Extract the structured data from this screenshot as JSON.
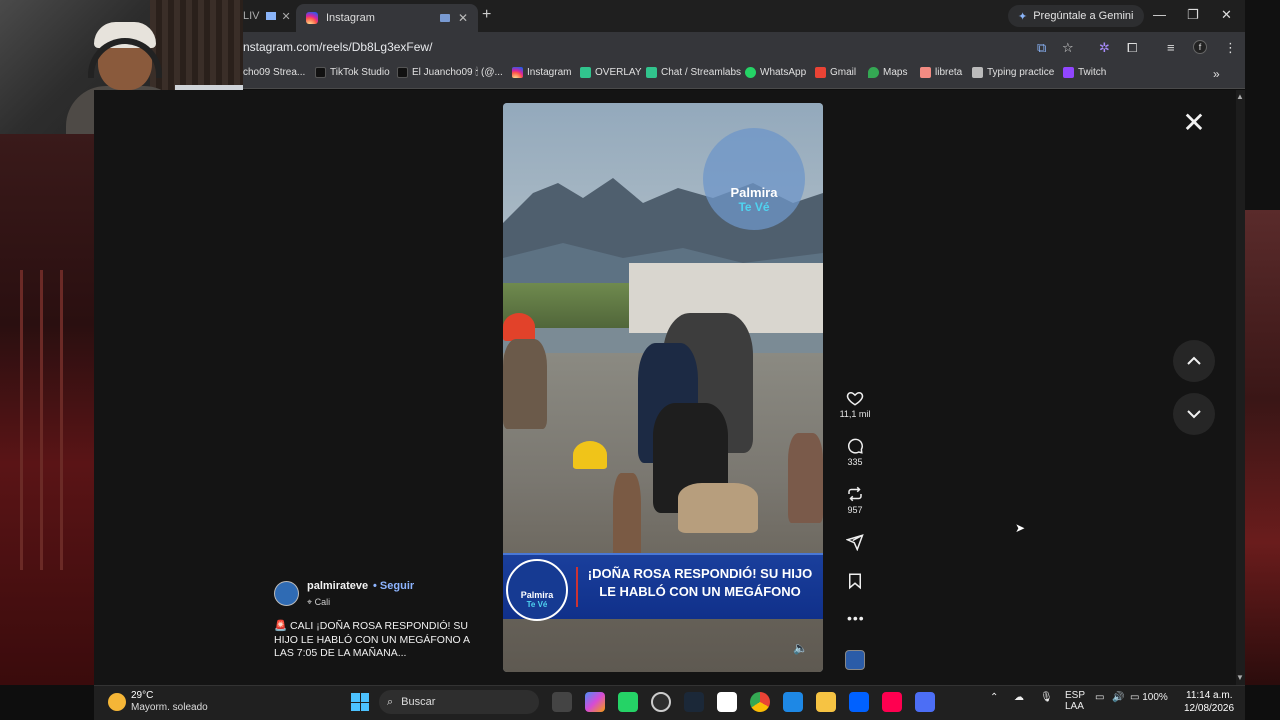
{
  "browser": {
    "partial_tab_label": "LIV",
    "active_tab_title": "Instagram",
    "new_tab_symbol": "+",
    "gemini_label": "Pregúntale a Gemini",
    "url": "nstagram.com/reels/Db8Lg3exFew/"
  },
  "bookmarks": [
    {
      "label": "cho09 Strea...",
      "icon": "streamlabs-icon",
      "color": "#80f5d2"
    },
    {
      "label": "TikTok Studio",
      "icon": "tiktok-icon",
      "color": "#ffffff"
    },
    {
      "label": "El Juancho09 🕯 (@...",
      "icon": "tiktok-icon",
      "color": "#ffffff"
    },
    {
      "label": "Instagram",
      "icon": "instagram-icon",
      "color": "#e1306c"
    },
    {
      "label": "OVERLAY",
      "icon": "overlay-icon",
      "color": "#31c48d"
    },
    {
      "label": "Chat / Streamlabs",
      "icon": "streamlabs-icon",
      "color": "#31c48d"
    },
    {
      "label": "WhatsApp",
      "icon": "whatsapp-icon",
      "color": "#25d366"
    },
    {
      "label": "Gmail",
      "icon": "gmail-icon",
      "color": "#ea4335"
    },
    {
      "label": "Maps",
      "icon": "maps-icon",
      "color": "#34a853"
    },
    {
      "label": "libreta",
      "icon": "notebook-icon",
      "color": "#f28b82"
    },
    {
      "label": "Typing practice",
      "icon": "keyboard-icon",
      "color": "#cccccc"
    },
    {
      "label": "Twitch",
      "icon": "twitch-icon",
      "color": "#9146ff"
    }
  ],
  "reel": {
    "logo_line1": "Palmira",
    "logo_line2": "Te Vé",
    "banner_text": "¡DOÑA ROSA RESPONDIÓ! SU HIJO LE HABLÓ CON UN MEGÁFONO"
  },
  "actions": {
    "likes": "11,1 mil",
    "comments": "335",
    "reposts": "957"
  },
  "post": {
    "author": "palmirateve",
    "separator": "•",
    "follow": "Seguir",
    "location": "Cali",
    "caption": "🚨 CALI ¡DOÑA ROSA RESPONDIÓ! SU HIJO LE HABLÓ CON UN MEGÁFONO A LAS 7:05 DE LA MAÑANA..."
  },
  "taskbar": {
    "temperature": "29°C",
    "weather": "Mayorm. soleado",
    "search_placeholder": "Buscar",
    "lang_line1": "ESP",
    "lang_line2": "LAA",
    "battery": "100%",
    "time": "11:14 a.m.",
    "date": "12/08/2026"
  },
  "colors": {
    "accent_link": "#8db4ff",
    "banner_blue": "#10308a"
  }
}
